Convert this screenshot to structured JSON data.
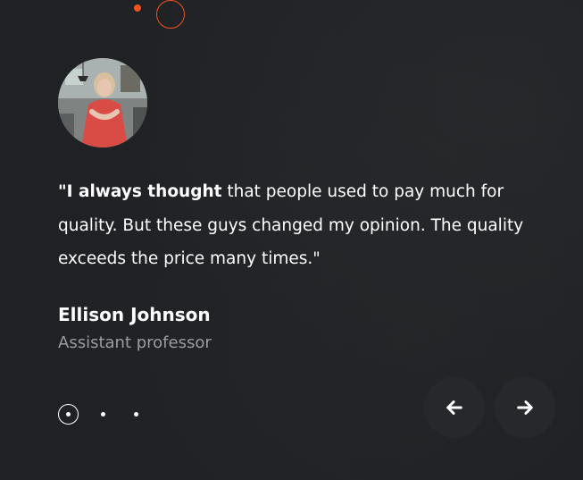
{
  "testimonial": {
    "quote_bold": "\"I always thought",
    "quote_rest": " that people used to pay much for quality. But these guys changed my opinion. The quality exceeds the price many times.\"",
    "author_name": "Ellison Johnson",
    "author_title": "Assistant professor"
  },
  "slider": {
    "total_slides": 3,
    "active_index": 0
  },
  "icons": {
    "prev": "arrow-left-icon",
    "next": "arrow-right-icon"
  },
  "colors": {
    "background": "#1f2125",
    "accent": "#f0511f",
    "text": "#ffffff",
    "muted": "#9b9da0"
  }
}
